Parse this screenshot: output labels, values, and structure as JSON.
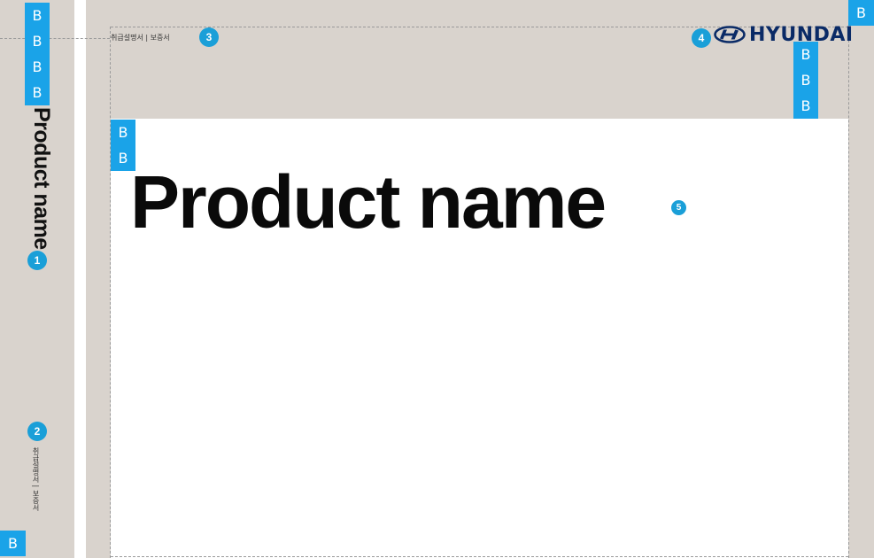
{
  "spine": {
    "title": "Product name",
    "links": "취급설명서 | 보증서",
    "badge_title": "1",
    "badge_links": "2"
  },
  "cover": {
    "links": "취급설명서 | 보증서",
    "badge_links": "3",
    "brand": "HYUNDAI",
    "badge_logo": "4",
    "title": "Product name",
    "badge_title": "5"
  },
  "margin_marker": "B",
  "colors": {
    "background": "#d9d3cd",
    "page": "#ffffff",
    "marker": "#1aa3e8",
    "badge": "#1a9fd8",
    "brand": "#0a2a66",
    "guide": "#9a9a9a"
  },
  "icons": {
    "brand_logo": "hyundai-h-logo-icon"
  }
}
